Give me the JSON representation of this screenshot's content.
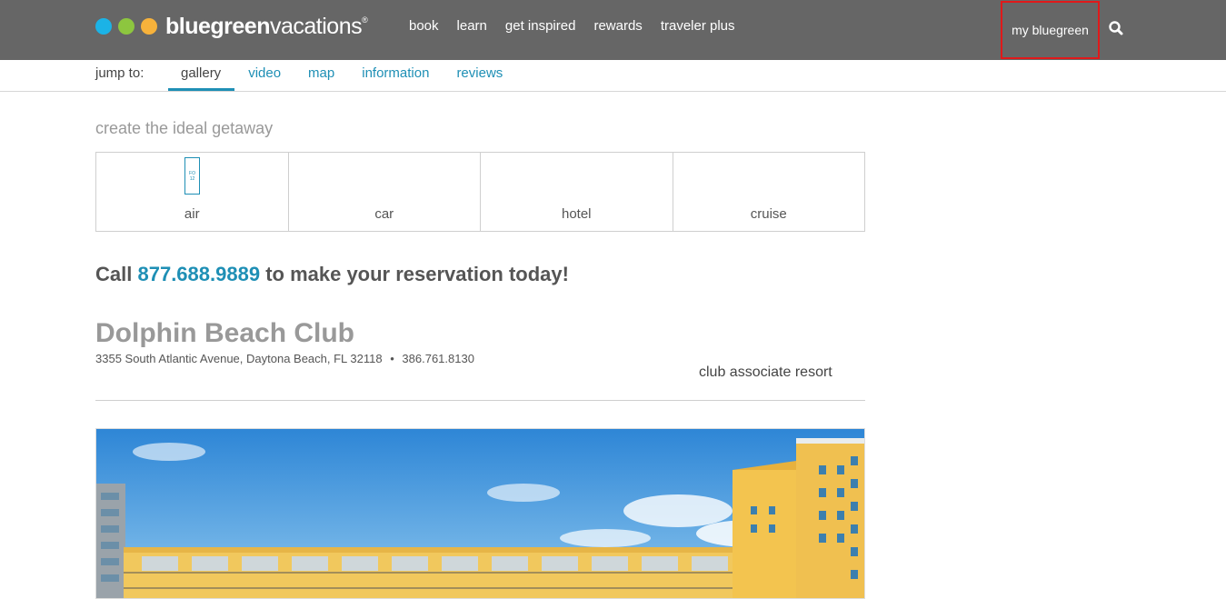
{
  "header": {
    "logo": {
      "bold": "bluegreen",
      "light": "vacations",
      "reg": "®",
      "dot_colors": [
        "#1bb3e6",
        "#8dc63f",
        "#f7b23b"
      ]
    },
    "nav": [
      "book",
      "learn",
      "get inspired",
      "rewards",
      "traveler plus"
    ],
    "account_label": "my bluegreen",
    "search_icon": "search-icon"
  },
  "jump": {
    "label": "jump to:",
    "links": [
      "gallery",
      "video",
      "map",
      "information",
      "reviews"
    ],
    "active": "gallery"
  },
  "getaway": {
    "title": "create the ideal getaway",
    "options": [
      "air",
      "car",
      "hotel",
      "cruise"
    ],
    "air_icon_text": [
      "FO",
      "12"
    ]
  },
  "call": {
    "prefix": "Call",
    "phone": "877.688.9889",
    "suffix": "to make your reservation today!"
  },
  "resort": {
    "name": "Dolphin Beach Club",
    "address": "3355 South Atlantic Avenue, Daytona Beach, FL 32118",
    "separator": "•",
    "phone": "386.761.8130",
    "type": "club associate resort"
  },
  "colors": {
    "header_bg": "#666666",
    "accent": "#1e8fb5",
    "highlight_border": "#e0191a"
  }
}
